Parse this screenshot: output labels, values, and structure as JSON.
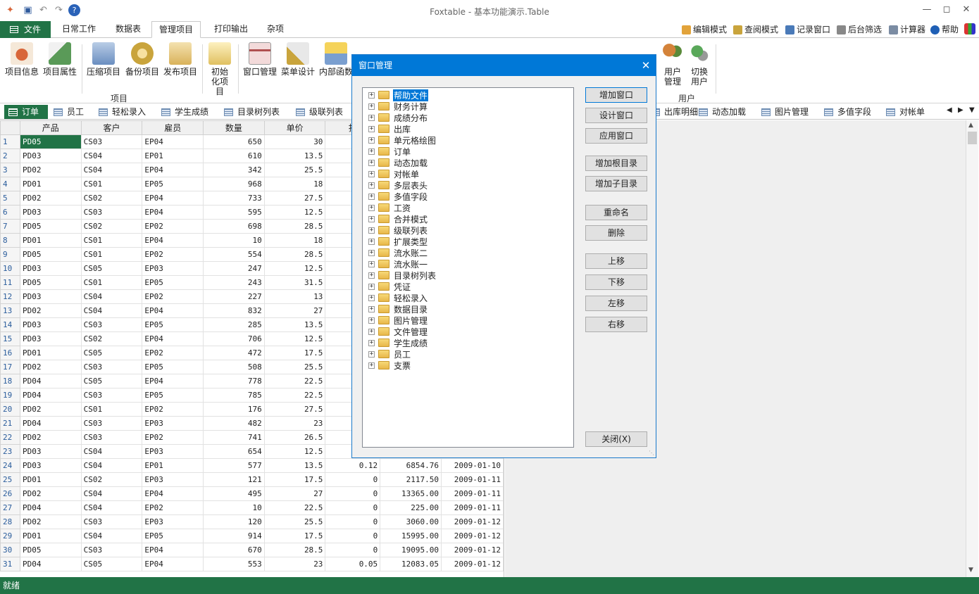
{
  "app": {
    "title": "Foxtable - 基本功能演示.Table",
    "quick_access": [
      "app-icon",
      "save-icon",
      "undo-icon",
      "redo-icon",
      "help-icon"
    ]
  },
  "menu_tabs": [
    {
      "label": "文件"
    },
    {
      "label": "日常工作"
    },
    {
      "label": "数据表"
    },
    {
      "label": "管理项目"
    },
    {
      "label": "打印输出"
    },
    {
      "label": "杂项"
    }
  ],
  "mode_bar": [
    {
      "label": "编辑模式",
      "color": "#e2a33a"
    },
    {
      "label": "查阅模式",
      "color": "#c9a43c"
    },
    {
      "label": "记录窗口",
      "color": "#4a7ab8"
    },
    {
      "label": "后台筛选",
      "color": "#888888"
    },
    {
      "label": "计算器",
      "color": "#7b8ca3"
    },
    {
      "label": "帮助",
      "color": "#1f5fb5"
    }
  ],
  "ribbon": {
    "buttons": [
      {
        "label": "项目信息",
        "color": "#d8663a"
      },
      {
        "label": "项目属性",
        "color": "#5a9a58"
      },
      {
        "label": "压缩项目",
        "color": "#6a8ec0"
      },
      {
        "label": "备份项目",
        "color": "#c9a43c"
      },
      {
        "label": "发布项目",
        "color": "#d9b25a"
      },
      {
        "label": "初始化项目",
        "color": "#e0c060"
      },
      {
        "label": "窗口管理",
        "color": "#b05050"
      },
      {
        "label": "菜单设计",
        "color": "#c9a43c"
      },
      {
        "label": "内部函数",
        "color": "#7a9fd0"
      },
      {
        "label": "用户管理",
        "color": "#d4833a"
      },
      {
        "label": "切换用户",
        "color": "#5aa85a"
      }
    ],
    "groups": {
      "project": "项目",
      "user": "用户"
    }
  },
  "window_tabs": {
    "left": [
      "订单",
      "员工",
      "轻松录入",
      "学生成绩",
      "目录树列表",
      "级联列表"
    ],
    "right": [
      "出库明细",
      "动态加载",
      "图片管理",
      "多值字段",
      "对帐单"
    ]
  },
  "grid": {
    "columns": [
      "产品",
      "客户",
      "雇员",
      "数量",
      "单价",
      "折",
      "",
      ""
    ],
    "rows": [
      [
        "PD05",
        "CS03",
        "EP04",
        "650",
        "30",
        "",
        "",
        ""
      ],
      [
        "PD03",
        "CS04",
        "EP01",
        "610",
        "13.5",
        "",
        "",
        ""
      ],
      [
        "PD02",
        "CS04",
        "EP04",
        "342",
        "25.5",
        "",
        "",
        ""
      ],
      [
        "PD01",
        "CS01",
        "EP05",
        "968",
        "18",
        "",
        "",
        ""
      ],
      [
        "PD02",
        "CS02",
        "EP04",
        "733",
        "27.5",
        "",
        "",
        ""
      ],
      [
        "PD03",
        "CS03",
        "EP04",
        "595",
        "12.5",
        "",
        "",
        ""
      ],
      [
        "PD05",
        "CS02",
        "EP02",
        "698",
        "28.5",
        "",
        "",
        ""
      ],
      [
        "PD01",
        "CS01",
        "EP04",
        "10",
        "18",
        "",
        "",
        ""
      ],
      [
        "PD05",
        "CS01",
        "EP02",
        "554",
        "28.5",
        "",
        "",
        ""
      ],
      [
        "PD03",
        "CS05",
        "EP03",
        "247",
        "12.5",
        "",
        "",
        ""
      ],
      [
        "PD05",
        "CS01",
        "EP05",
        "243",
        "31.5",
        "",
        "",
        ""
      ],
      [
        "PD03",
        "CS04",
        "EP02",
        "227",
        "13",
        "",
        "",
        ""
      ],
      [
        "PD02",
        "CS04",
        "EP04",
        "832",
        "27",
        "",
        "",
        ""
      ],
      [
        "PD03",
        "CS03",
        "EP05",
        "285",
        "13.5",
        "",
        "",
        ""
      ],
      [
        "PD03",
        "CS02",
        "EP04",
        "706",
        "12.5",
        "",
        "",
        ""
      ],
      [
        "PD01",
        "CS05",
        "EP02",
        "472",
        "17.5",
        "",
        "",
        ""
      ],
      [
        "PD02",
        "CS03",
        "EP05",
        "508",
        "25.5",
        "",
        "",
        ""
      ],
      [
        "PD04",
        "CS05",
        "EP04",
        "778",
        "22.5",
        "",
        "",
        ""
      ],
      [
        "PD04",
        "CS03",
        "EP05",
        "785",
        "22.5",
        "",
        "",
        ""
      ],
      [
        "PD02",
        "CS01",
        "EP02",
        "176",
        "27.5",
        "",
        "",
        ""
      ],
      [
        "PD04",
        "CS03",
        "EP03",
        "482",
        "23",
        "",
        "",
        ""
      ],
      [
        "PD02",
        "CS03",
        "EP02",
        "741",
        "26.5",
        "",
        "",
        ""
      ],
      [
        "PD03",
        "CS04",
        "EP03",
        "654",
        "12.5",
        "",
        "",
        ""
      ],
      [
        "PD03",
        "CS04",
        "EP01",
        "577",
        "13.5",
        "0.12",
        "6854.76",
        "2009-01-10"
      ],
      [
        "PD01",
        "CS02",
        "EP03",
        "121",
        "17.5",
        "0",
        "2117.50",
        "2009-01-11"
      ],
      [
        "PD02",
        "CS04",
        "EP04",
        "495",
        "27",
        "0",
        "13365.00",
        "2009-01-11"
      ],
      [
        "PD04",
        "CS04",
        "EP02",
        "10",
        "22.5",
        "0",
        "225.00",
        "2009-01-11"
      ],
      [
        "PD02",
        "CS03",
        "EP03",
        "120",
        "25.5",
        "0",
        "3060.00",
        "2009-01-12"
      ],
      [
        "PD01",
        "CS04",
        "EP05",
        "914",
        "17.5",
        "0",
        "15995.00",
        "2009-01-12"
      ],
      [
        "PD05",
        "CS03",
        "EP04",
        "670",
        "28.5",
        "0",
        "19095.00",
        "2009-01-12"
      ],
      [
        "PD04",
        "CS05",
        "EP04",
        "553",
        "23",
        "0.05",
        "12083.05",
        "2009-01-12"
      ]
    ]
  },
  "status": {
    "text": "就绪"
  },
  "dialog": {
    "title": "窗口管理",
    "tree": [
      "帮助文件",
      "财务计算",
      "成绩分布",
      "出库",
      "单元格绘图",
      "订单",
      "动态加载",
      "对帐单",
      "多层表头",
      "多值字段",
      "工资",
      "合并模式",
      "级联列表",
      "扩展类型",
      "流水账二",
      "流水账一",
      "目录树列表",
      "凭证",
      "轻松录入",
      "数据目录",
      "图片管理",
      "文件管理",
      "学生成绩",
      "员工",
      "支票"
    ],
    "buttons": {
      "add_window": "增加窗口",
      "design_window": "设计窗口",
      "apply_window": "应用窗口",
      "add_root": "增加根目录",
      "add_child": "增加子目录",
      "rename": "重命名",
      "delete": "删除",
      "move_up": "上移",
      "move_down": "下移",
      "move_left": "左移",
      "move_right": "右移",
      "close": "关闭(X)"
    }
  }
}
